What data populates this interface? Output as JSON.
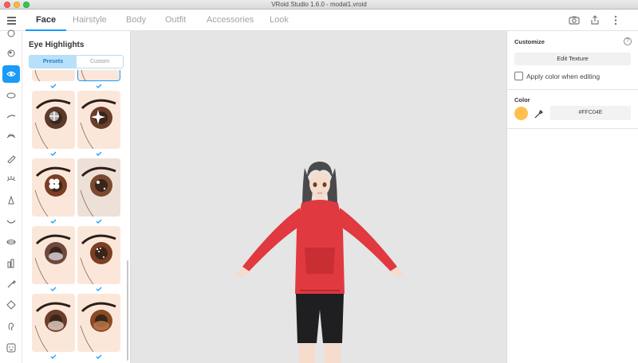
{
  "window": {
    "title": "VRoid Studio 1.6.0 - modal1.vroid"
  },
  "nav": {
    "tabs": [
      {
        "label": "Face"
      },
      {
        "label": "Hairstyle"
      },
      {
        "label": "Body"
      },
      {
        "label": "Outfit"
      },
      {
        "label": "Accessories"
      },
      {
        "label": "Look"
      }
    ],
    "active_tab": "Face",
    "right_icons": [
      "camera-icon",
      "export-icon",
      "more-vertical-icon"
    ]
  },
  "tools": {
    "icons": [
      "face-outline-icon",
      "eye-iris-icon",
      "eye-highlight-icon",
      "eye-white-icon",
      "eyebrow-icon",
      "eyelid-icon",
      "eyeliner-icon",
      "eyelash-icon",
      "nose-icon",
      "mouth-icon",
      "lips-icon",
      "tooth-icon",
      "makeup-brush-icon",
      "face-shape-icon",
      "ear-icon",
      "cheek-icon"
    ],
    "active_icon": "eye-highlight-icon"
  },
  "panel": {
    "title": "Eye Highlights",
    "segments": {
      "presets": "Presets",
      "custom": "Custom"
    },
    "active_segment": "Presets",
    "thumbnails": [
      {
        "id": "top-left",
        "selected": false
      },
      {
        "id": "top-right",
        "selected": true
      },
      {
        "id": "gray-cross-highlight",
        "selected": false
      },
      {
        "id": "star-sparkle",
        "selected": false
      },
      {
        "id": "flower-highlight",
        "selected": false
      },
      {
        "id": "small-dots-dark",
        "selected": false
      },
      {
        "id": "lavender-soft",
        "selected": false
      },
      {
        "id": "dot-cluster",
        "selected": false
      },
      {
        "id": "gradient-light",
        "selected": false
      },
      {
        "id": "warm-gradient",
        "selected": false
      }
    ]
  },
  "customize": {
    "heading": "Customize",
    "edit_texture": "Edit Texture",
    "apply_color_label": "Apply color when editing",
    "apply_color_checked": false,
    "color_heading": "Color",
    "hex": "#FFC04E",
    "swatch_color": "#FFC04E"
  },
  "colors": {
    "accent": "#1B9AF6",
    "hoodie": "#E0393F",
    "hair": "#4A4A4C",
    "skin": "#FBE7DA"
  }
}
